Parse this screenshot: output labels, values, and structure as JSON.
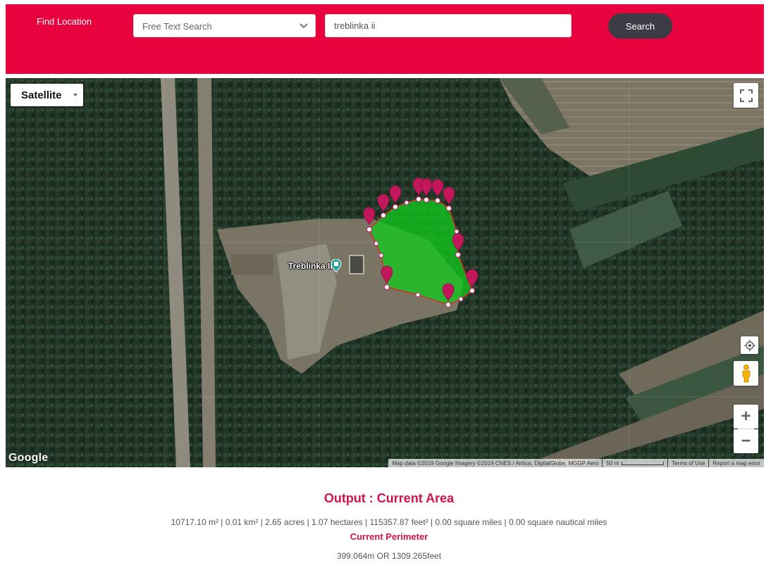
{
  "header": {
    "find_label": "Find Location",
    "search_type": "Free Text Search",
    "search_value": "treblinka ii",
    "search_button": "Search",
    "color": "#e8033e"
  },
  "map": {
    "map_type": "Satellite",
    "place_label": "Treblinka II",
    "zoom_in": "+",
    "zoom_out": "−",
    "logo": "Google",
    "attribution": "Map data ©2019 Google Imagery ©2019 CNES / Airbus, DigitalGlobe, MGGP Aero",
    "scale_label": "50 m",
    "terms": "Terms of Use",
    "report": "Report a map error",
    "polygon_color": "#12c81e",
    "marker_color": "#c2185b",
    "icons": [
      "fullscreen-icon",
      "my-location-icon",
      "pegman-icon",
      "chevron-down-icon",
      "place-marker-icon"
    ]
  },
  "output": {
    "title": "Output : Current Area",
    "area_values": "10717.10 m² | 0.01 km² | 2.65 acres | 1.07 hectares | 115357.87 feet² | 0.00 square miles | 0.00 square nautical miles",
    "perimeter_title": "Current Perimeter",
    "perimeter_values": "399.064m OR 1309.265feet",
    "accent_color": "#d1134c"
  }
}
